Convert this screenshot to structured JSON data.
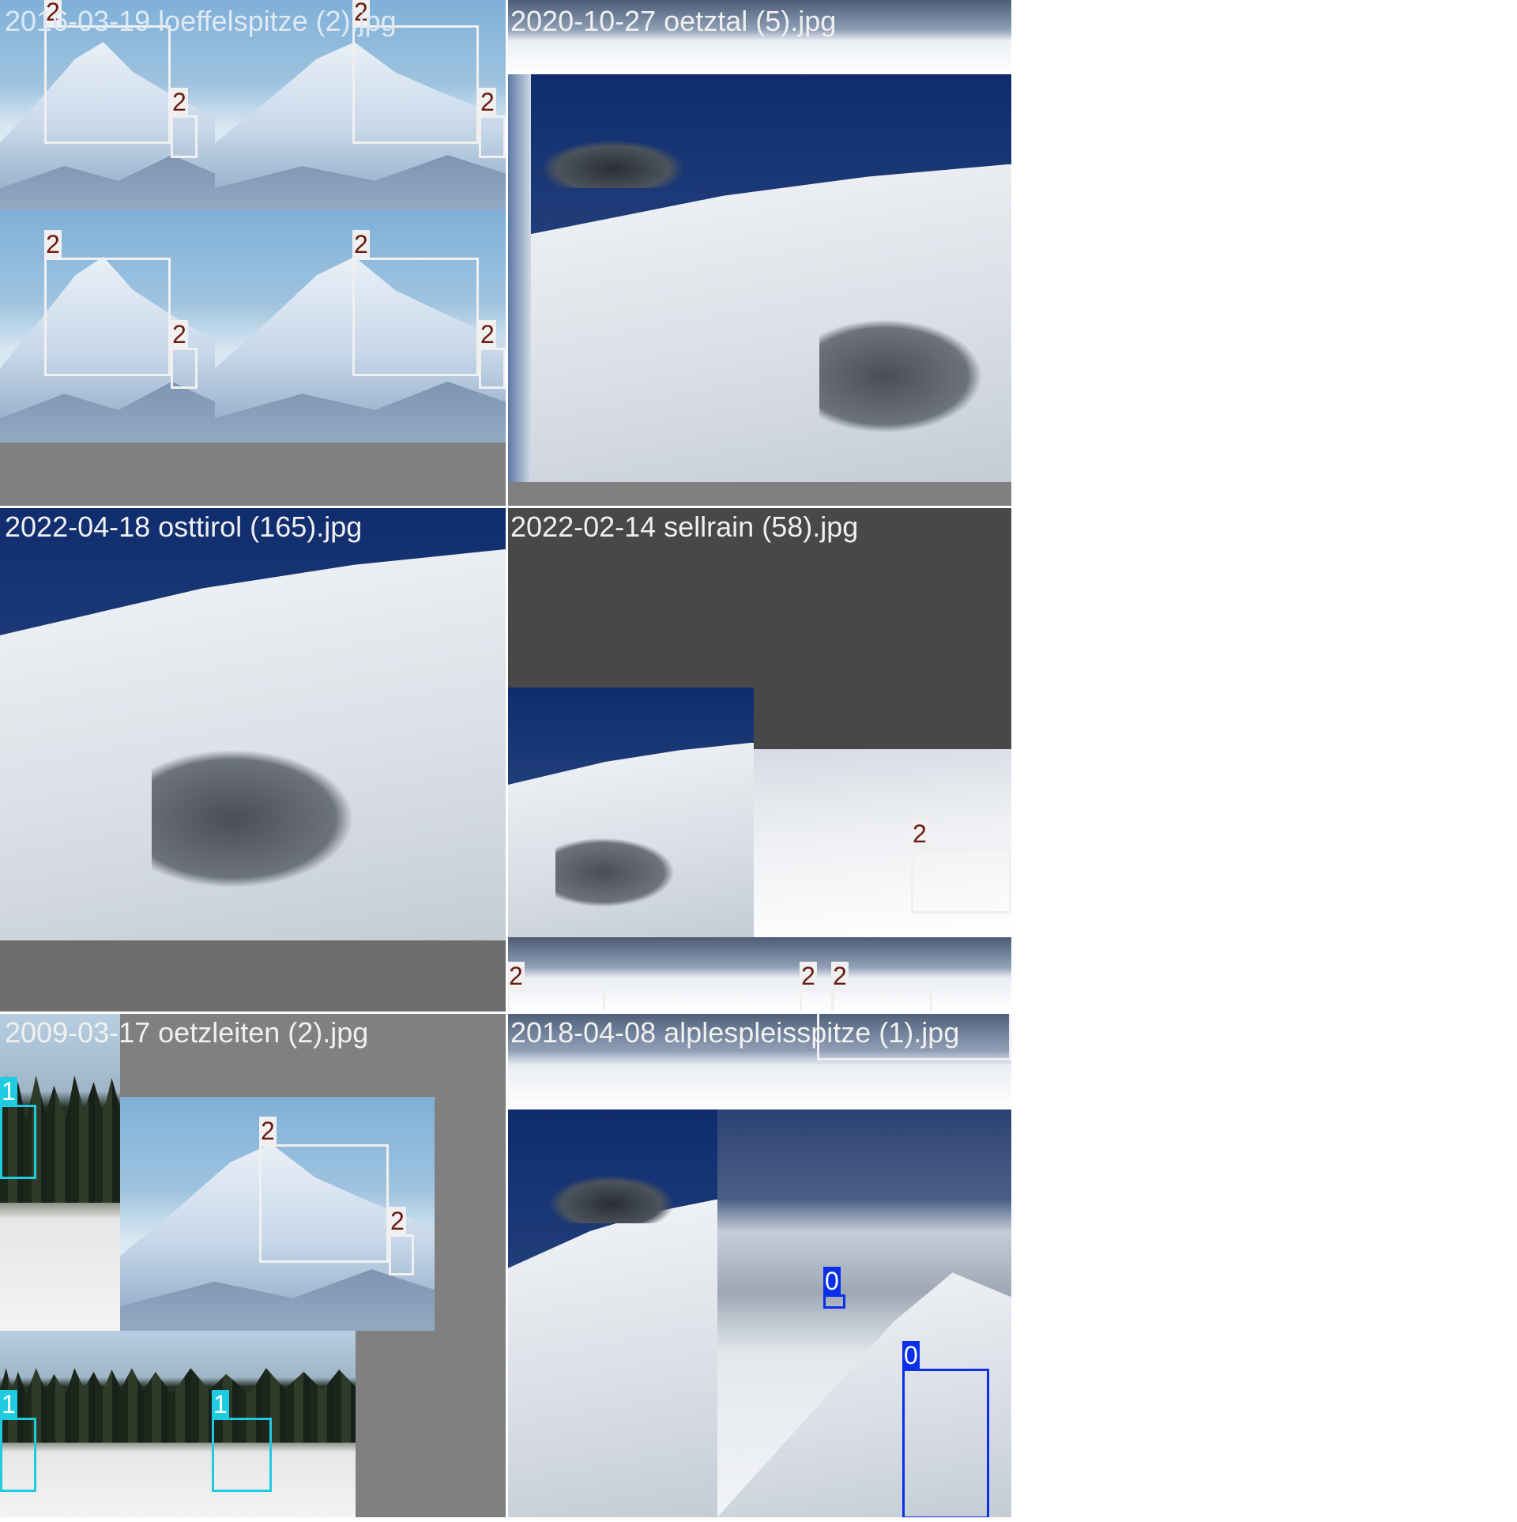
{
  "mosaic": {
    "cells": [
      {
        "title": "2016-03-19 loeffelspitze (2).jpg"
      },
      {
        "title": "2020-10-27 oetztal (5).jpg"
      },
      {
        "title": "2022-04-18 osttirol (165).jpg"
      },
      {
        "title": "2022-02-14 sellrain (58).jpg"
      },
      {
        "title": "2009-03-17 oetzleiten (2).jpg"
      },
      {
        "title": "2018-04-08 alplespleisspitze (1).jpg"
      }
    ]
  },
  "labels": {
    "class_0": "0",
    "class_1": "1",
    "class_2": "2"
  },
  "colors": {
    "class_0": "#0a2fe8",
    "class_1": "#1ecbe1",
    "class_2": "#f0f0f0",
    "label_text_class_2": "#6b1a10",
    "padding_gray": "#808080"
  }
}
